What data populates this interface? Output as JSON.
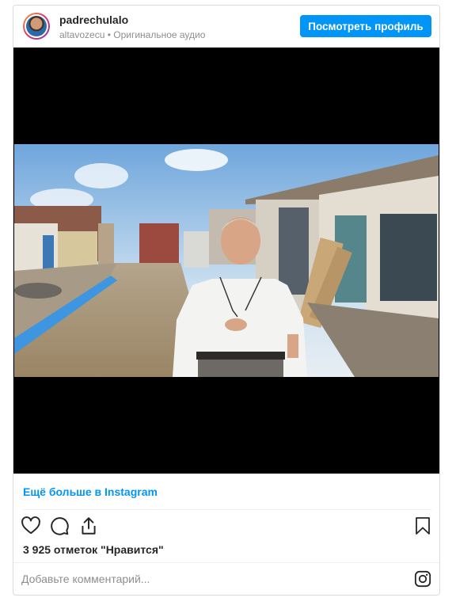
{
  "header": {
    "username": "padrechulalo",
    "subtitle": "altavozecu • Оригинальное аудио",
    "view_profile_label": "Посмотреть профиль"
  },
  "media": {
    "type": "video",
    "scene": "flooded street"
  },
  "footer": {
    "more_link": "Ещё больше в Instagram",
    "likes_text": "3 925 отметок \"Нравится\"",
    "comment_placeholder": "Добавьте комментарий..."
  },
  "icons": {
    "like": "heart-icon",
    "comment": "comment-icon",
    "share": "share-icon",
    "save": "bookmark-icon",
    "brand": "instagram-icon"
  },
  "colors": {
    "accent": "#0095f6",
    "text": "#262626",
    "muted": "#8e8e8e",
    "border": "#dbdbdb"
  }
}
